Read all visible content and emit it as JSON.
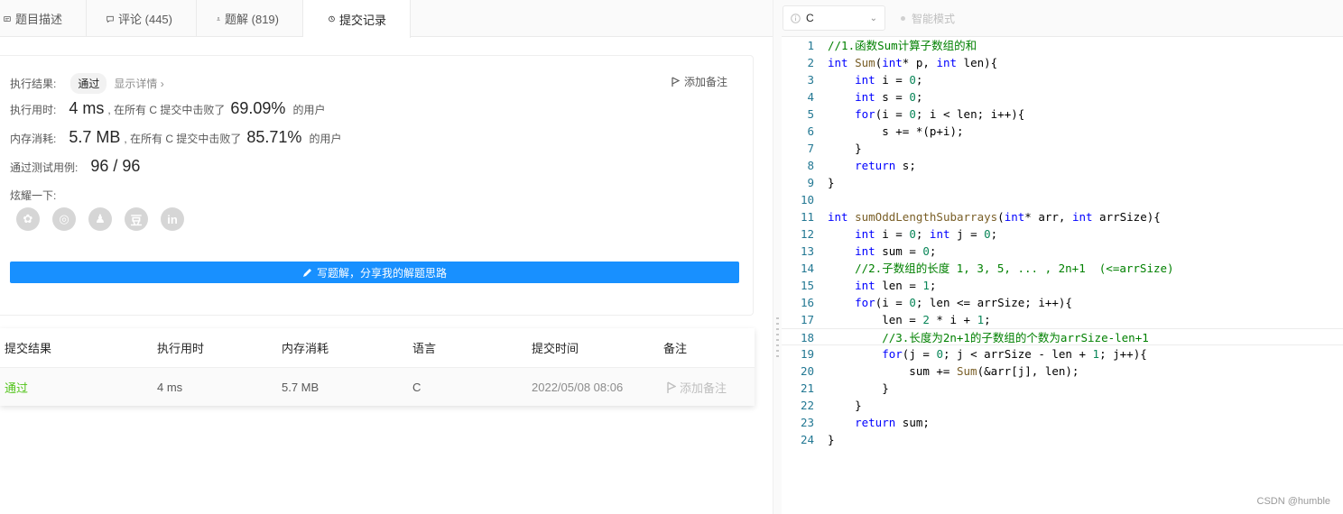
{
  "tabs": [
    {
      "label": "题目描述"
    },
    {
      "label": "评论 (445)"
    },
    {
      "label": "题解 (819)"
    },
    {
      "label": "提交记录"
    }
  ],
  "result": {
    "label": "执行结果:",
    "status": "通过",
    "detail": "显示详情 ›",
    "add_note": "添加备注",
    "runtime_label": "执行用时:",
    "runtime_value": "4 ms",
    "runtime_mid": ", 在所有 C 提交中击败了",
    "runtime_pct": "69.09%",
    "runtime_suffix": "的用户",
    "memory_label": "内存消耗:",
    "memory_value": "5.7 MB",
    "memory_mid": ", 在所有 C 提交中击败了",
    "memory_pct": "85.71%",
    "memory_suffix": "的用户",
    "tests_label": "通过测试用例:",
    "tests_value": "96 / 96",
    "share_label": "炫耀一下:",
    "share_icons": [
      "wechat-icon",
      "weibo-icon",
      "qq-icon",
      "douban-icon",
      "linkedin-icon"
    ],
    "share_glyphs": [
      "✿",
      "◎",
      "♟",
      "豆",
      "in"
    ],
    "write_button": "写题解，分享我的解题思路"
  },
  "table": {
    "headers": [
      "提交结果",
      "执行用时",
      "内存消耗",
      "语言",
      "提交时间",
      "备注"
    ],
    "row": {
      "result": "通过",
      "runtime": "4 ms",
      "memory": "5.7 MB",
      "language": "C",
      "time": "2022/05/08 08:06",
      "note": "添加备注"
    }
  },
  "editor": {
    "language": "C",
    "smart_mode": "智能模式",
    "lines": [
      "1",
      "2",
      "3",
      "4",
      "5",
      "6",
      "7",
      "8",
      "9",
      "10",
      "11",
      "12",
      "13",
      "14",
      "15",
      "16",
      "17",
      "18",
      "19",
      "20",
      "21",
      "22",
      "23",
      "24"
    ]
  },
  "watermark": "CSDN @humble",
  "colors": {
    "accent": "#1890ff",
    "pass": "#52c41a",
    "keyword": "#0000ff",
    "comment": "#008000",
    "number": "#098658"
  }
}
